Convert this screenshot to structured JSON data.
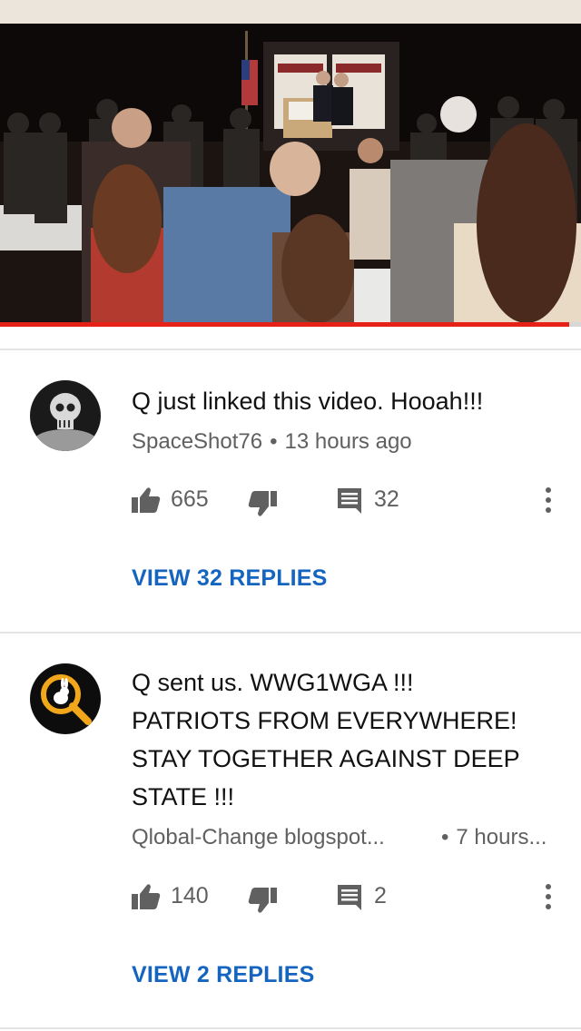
{
  "video": {
    "progress_percent": 98,
    "colors": {
      "progress": "#e62117",
      "track": "#d7d7d7"
    }
  },
  "comments": [
    {
      "avatar_icon": "skull-avatar-icon",
      "text_lines": [
        "Q just linked this video. Hooah!!!"
      ],
      "author": "SpaceShot76",
      "time": "13 hours ago",
      "likes": "665",
      "replies_count": "32",
      "view_replies": "VIEW 32 REPLIES"
    },
    {
      "avatar_icon": "rabbit-magnifier-avatar-icon",
      "text_lines": [
        "Q sent us. WWG1WGA !!!",
        "PATRIOTS FROM EVERYWHERE!",
        "STAY TOGETHER AGAINST DEEP",
        "STATE !!!"
      ],
      "author": "Qlobal-Change blogspot...",
      "time": "7 hours...",
      "likes": "140",
      "replies_count": "2",
      "view_replies": "VIEW 2 REPLIES"
    }
  ],
  "icons": {
    "like": "thumbs-up-icon",
    "dislike": "thumbs-down-icon",
    "reply": "reply-comment-icon",
    "more": "more-vertical-icon"
  },
  "colors": {
    "link": "#1565c0",
    "meta": "#606060"
  }
}
